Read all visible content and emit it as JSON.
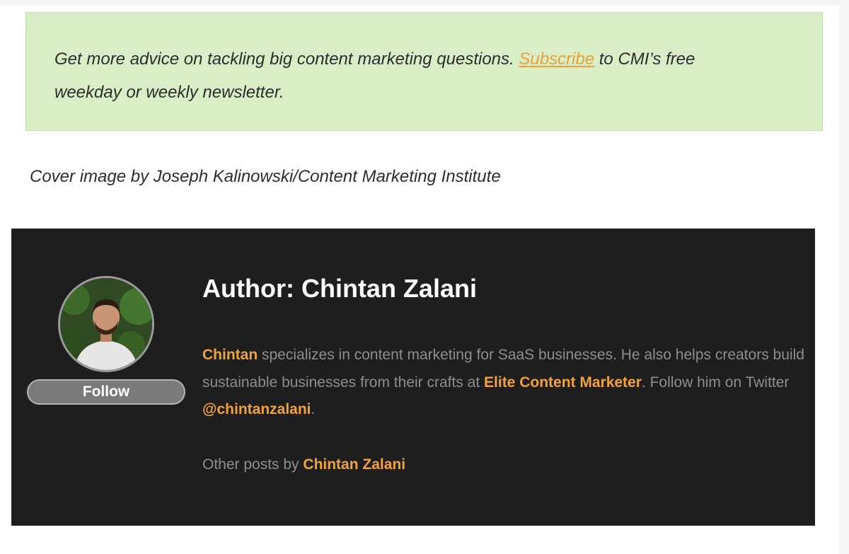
{
  "promo": {
    "text_before": "Get more advice on tackling big content marketing questions. ",
    "link_label": "Subscribe",
    "text_after_line1": " to CMI’s free",
    "text_line2": "weekday or weekly newsletter."
  },
  "caption": "Cover image by Joseph Kalinowski/Content Marketing Institute",
  "author": {
    "title": "Author: Chintan Zalani",
    "follow_label": "Follow",
    "bio": {
      "name_link": "Chintan",
      "text1": " specializes in content marketing for SaaS businesses. He also helps creators build sustainable businesses from their crafts at ",
      "site_link": "Elite Content Marketer",
      "text2": ". Follow him on Twitter ",
      "twitter_link": "@chintanzalani",
      "text3": "."
    },
    "other_posts_prefix": "Other posts by ",
    "other_posts_link": "Chintan Zalani"
  },
  "colors": {
    "promo_bg": "#d9edc7",
    "link_orange": "#f0a33a",
    "author_bg": "#1e1e1e"
  }
}
